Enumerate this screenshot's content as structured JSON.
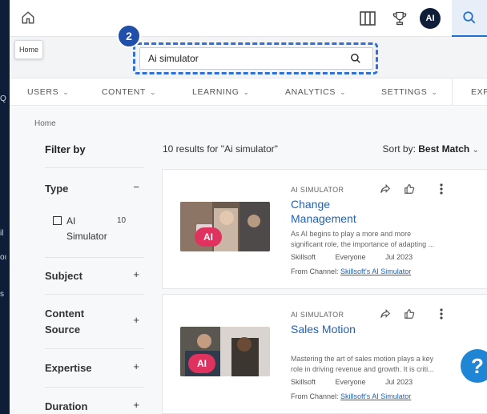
{
  "tooltip": {
    "text": "Home"
  },
  "left_strip": {
    "glyphs": [
      "Q",
      "il",
      "oı",
      "s"
    ]
  },
  "topbar": {
    "icons": [
      "home-icon",
      "columns-icon",
      "trophy-icon",
      "search-icon"
    ],
    "avatar_initials": "AI"
  },
  "search": {
    "value": "Ai simulator",
    "step_badge": "2",
    "highlight_color": "#2f6fd6"
  },
  "nav": {
    "items": [
      {
        "label": "USERS"
      },
      {
        "label": "CONTENT"
      },
      {
        "label": "LEARNING"
      },
      {
        "label": "ANALYTICS"
      },
      {
        "label": "SETTINGS"
      },
      {
        "label": "EXP"
      }
    ]
  },
  "breadcrumb": "Home",
  "filters": {
    "title": "Filter by",
    "groups": [
      {
        "label": "Type",
        "toggle": "−"
      },
      {
        "label": "Subject",
        "toggle": "+"
      },
      {
        "label": "Content Source",
        "toggle": "+"
      },
      {
        "label": "Expertise",
        "toggle": "+"
      },
      {
        "label": "Duration",
        "toggle": "+"
      }
    ],
    "type_option": {
      "label": "AI Simulator",
      "count": "10"
    }
  },
  "results": {
    "summary": "10 results for \"Ai simulator\"",
    "sort_label": "Sort by:",
    "sort_value": "Best Match",
    "cards": [
      {
        "type": "AI SIMULATOR",
        "title": "Change Management",
        "description": "As AI begins to play a more and more significant role, the importance of adapting ...",
        "provider": "Skillsoft",
        "audience": "Everyone",
        "date": "Jul 2023",
        "channel_label": "From Channel:",
        "channel_link": "Skillsoft's AI Simulator",
        "badge": "AI"
      },
      {
        "type": "AI SIMULATOR",
        "title": "Sales Motion",
        "description": "Mastering the art of sales motion plays a key role in driving revenue and growth. It is criti...",
        "provider": "Skillsoft",
        "audience": "Everyone",
        "date": "Jul 2023",
        "channel_label": "From Channel:",
        "channel_link": "Skillsoft's AI Simulator",
        "badge": "AI"
      }
    ]
  },
  "help": {
    "glyph": "?"
  },
  "colors": {
    "brand_dark": "#0f1e38",
    "link": "#1f62b8",
    "ai_badge": "#e0325f",
    "help_button": "#1f86d6"
  }
}
